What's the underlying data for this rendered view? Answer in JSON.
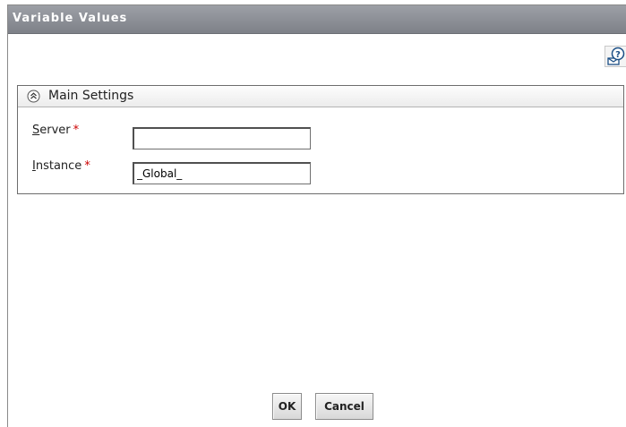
{
  "dialog": {
    "title": "Variable Values"
  },
  "toolbar": {
    "help_icon": "help-icon"
  },
  "panel": {
    "title": "Main Settings",
    "collapse_icon": "collapse-up-icon"
  },
  "fields": {
    "server": {
      "label_first": "S",
      "label_rest": "erver",
      "required_mark": "*",
      "value": ""
    },
    "instance": {
      "label_first": "I",
      "label_rest": "nstance",
      "required_mark": "*",
      "value": "_Global_"
    }
  },
  "buttons": {
    "ok": "OK",
    "cancel": "Cancel"
  },
  "colors": {
    "titlebar": "#8e9197",
    "required": "#cc0000",
    "panel_border": "#6d6d6d"
  }
}
